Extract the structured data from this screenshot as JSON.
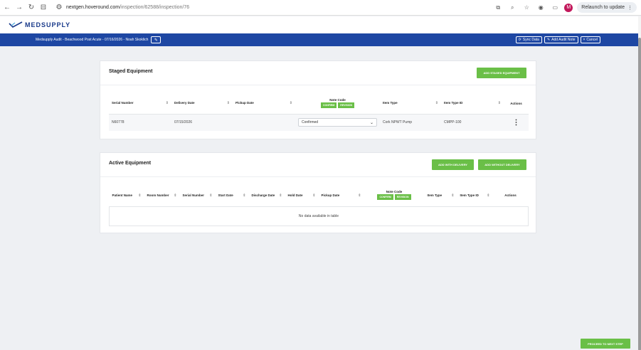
{
  "browser": {
    "url_host": "nextgen.hoveround.com",
    "url_path": "/inspection/62588/inspection/76",
    "avatar_letter": "M",
    "relaunch_label": "Relaunch to update"
  },
  "app": {
    "logo_text": "MEDSUPPLY",
    "audit_title": "Medsupply Audit - Beachwood Post Acute - 07/16/2026 - Noah Skoklich",
    "sync_label": "Sync Data",
    "add_note_label": "Add Audit Note",
    "cancel_label": "Cancel"
  },
  "staged": {
    "title": "Staged Equipment",
    "add_button": "ADD STAGED EQUIPMENT",
    "columns": {
      "serial": "Serial Number",
      "delivery": "Delivery Date",
      "pickup": "Pickup Date",
      "note_code": "Note Code",
      "item_type": "Item Type",
      "item_type_id": "Item Type ID",
      "actions": "Actions"
    },
    "confirm_label": "CONFIRM",
    "revision_label": "REVISION",
    "rows": [
      {
        "serial": "N60778",
        "delivery": "07/15/2026",
        "pickup": "",
        "note_code": "Confirmed",
        "item_type": "Cork NPWT Pump",
        "item_type_id": "CMPP-100"
      }
    ]
  },
  "active": {
    "title": "Active Equipment",
    "add_with_delivery": "ADD WITH DELIVERY",
    "add_without_delivery": "ADD WITHOUT DELIVERY",
    "columns": {
      "patient_name": "Patient Name",
      "room_number": "Room Number",
      "serial": "Serial Number",
      "start_date": "Start Date",
      "discharge_date": "Discharge Date",
      "hold_date": "Hold Date",
      "pickup_date": "Pickup Date",
      "note_code": "Note Code",
      "item_type": "Item Type",
      "item_type_id": "Item Type ID",
      "actions": "Actions"
    },
    "confirm_label": "CONFIRM",
    "revision_label": "REVISION",
    "empty_message": "No data available in table"
  },
  "footer": {
    "proceed_label": "PROCEED TO NEXT STEP"
  },
  "colors": {
    "brand_blue": "#1e47a3",
    "action_green": "#6abf47"
  }
}
